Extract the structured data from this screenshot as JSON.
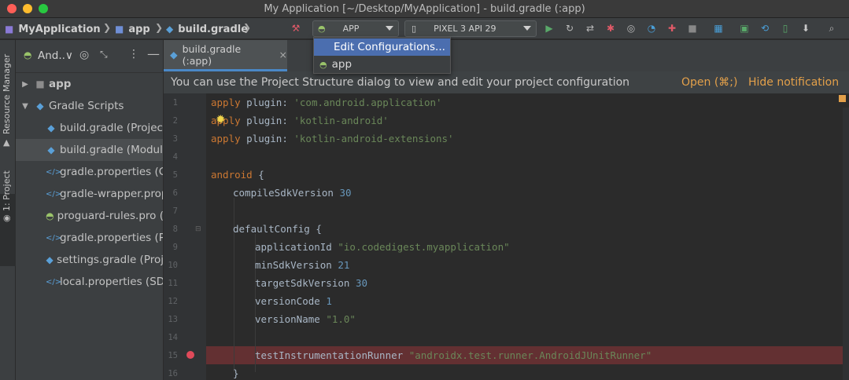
{
  "window": {
    "title": "My Application [~/Desktop/MyApplication] - build.gradle (:app)"
  },
  "breadcrumbs": [
    {
      "label": "MyApplication",
      "icon": "folder-icon"
    },
    {
      "label": "app",
      "icon": "module-folder-icon"
    },
    {
      "label": "build.gradle",
      "icon": "gradle-elephant-icon"
    }
  ],
  "toolbar": {
    "run_config": "APP",
    "device": "PIXEL 3 API 29"
  },
  "dropdown": {
    "items": [
      "Edit Configurations...",
      "app"
    ]
  },
  "sidebar": {
    "resource_manager": "Resource Manager",
    "project_tab": "1: Project"
  },
  "project_panel": {
    "view_selector": "And..∨",
    "tree": [
      {
        "label": "app",
        "expanded": false,
        "icon": "folder-icon"
      },
      {
        "label": "Gradle Scripts",
        "expanded": true,
        "icon": "gradle-elephant-icon"
      },
      {
        "label": "build.gradle (Projec",
        "icon": "gradle-elephant-icon"
      },
      {
        "label": "build.gradle (Modul",
        "icon": "gradle-elephant-icon",
        "selected": true
      },
      {
        "label": "gradle.properties (G",
        "icon": "properties-icon"
      },
      {
        "label": "gradle-wrapper.prop",
        "icon": "properties-icon"
      },
      {
        "label": "proguard-rules.pro (",
        "icon": "android-icon"
      },
      {
        "label": "gradle.properties (P",
        "icon": "properties-icon"
      },
      {
        "label": "settings.gradle (Proj",
        "icon": "gradle-elephant-icon"
      },
      {
        "label": "local.properties (SD",
        "icon": "properties-icon"
      }
    ]
  },
  "editor": {
    "tab_label": "build.gradle (:app)",
    "notification": "You can use the Project Structure dialog to view and edit your project configuration",
    "open_link": "Open (⌘;)",
    "hide_link": "Hide notification",
    "line_numbers": [
      "1",
      "2",
      "3",
      "4",
      "5",
      "6",
      "7",
      "8",
      "9",
      "10",
      "11",
      "12",
      "13",
      "14",
      "15",
      "16"
    ],
    "code": {
      "l1_kw": "apply",
      "l1_mid": " plugin: ",
      "l1_str": "'com.android.application'",
      "l2_kw": "apply",
      "l2_mid": " plugin: ",
      "l2_str": "'kotlin-android'",
      "l3_kw": "apply",
      "l3_mid": " plugin: ",
      "l3_str": "'kotlin-android-extensions'",
      "l5_kw": "android",
      "l5_rest": " {",
      "l6_id": "compileSdkVersion",
      "l6_num": "30",
      "l8_id": "defaultConfig",
      "l8_rest": " {",
      "l9_id": "applicationId",
      "l9_str": "\"io.codedigest.myapplication\"",
      "l10_id": "minSdkVersion",
      "l10_num": "21",
      "l11_id": "targetSdkVersion",
      "l11_num": "30",
      "l12_id": "versionCode",
      "l12_num": "1",
      "l13_id": "versionName",
      "l13_str": "\"1.0\"",
      "l15_id": "testInstrumentationRunner",
      "l15_str": "\"androidx.test.runner.AndroidJUnitRunner\"",
      "l16_rest": "}"
    }
  },
  "colors": {
    "accent_link": "#e3a04a",
    "breakpoint_line": "#633032",
    "selection": "#4b6eaf"
  }
}
